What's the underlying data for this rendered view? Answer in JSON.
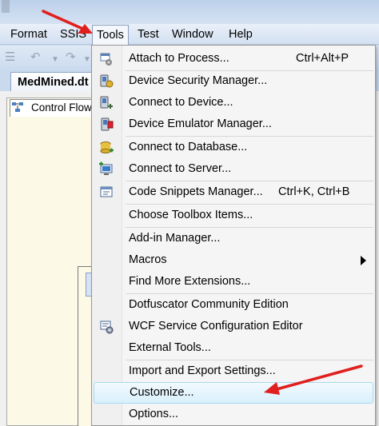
{
  "menubar": {
    "items": [
      {
        "label": "Format"
      },
      {
        "label": "SSIS"
      },
      {
        "label": "Tools"
      },
      {
        "label": "Test"
      },
      {
        "label": "Window"
      },
      {
        "label": "Help"
      }
    ]
  },
  "document": {
    "tab_label": "MedMined.dt",
    "designer_tab_label": "Control Flow"
  },
  "tools_menu": {
    "items": [
      {
        "label": "Attach to Process...",
        "shortcut": "Ctrl+Alt+P",
        "icon": "attach-process-icon"
      },
      {
        "label": "Device Security Manager...",
        "icon": "device-security-icon"
      },
      {
        "label": "Connect to Device...",
        "icon": "connect-device-icon"
      },
      {
        "label": "Device Emulator Manager...",
        "icon": "device-emulator-icon"
      },
      {
        "label": "Connect to Database...",
        "icon": "connect-database-icon"
      },
      {
        "label": "Connect to Server...",
        "icon": "connect-server-icon"
      },
      {
        "label": "Code Snippets Manager...",
        "shortcut": "Ctrl+K, Ctrl+B",
        "icon": "code-snippets-icon"
      },
      {
        "label": "Choose Toolbox Items..."
      },
      {
        "label": "Add-in Manager..."
      },
      {
        "label": "Macros",
        "submenu": true
      },
      {
        "label": "Find More Extensions..."
      },
      {
        "label": "Dotfuscator Community Edition"
      },
      {
        "label": "WCF Service Configuration Editor",
        "icon": "wcf-config-icon"
      },
      {
        "label": "External Tools..."
      },
      {
        "label": "Import and Export Settings..."
      },
      {
        "label": "Customize...",
        "highlighted": true
      },
      {
        "label": "Options..."
      }
    ]
  },
  "colors": {
    "annotation_arrow": "#e0201e",
    "highlight_border": "#a8d8f0",
    "menu_background": "#f5f5f5"
  }
}
